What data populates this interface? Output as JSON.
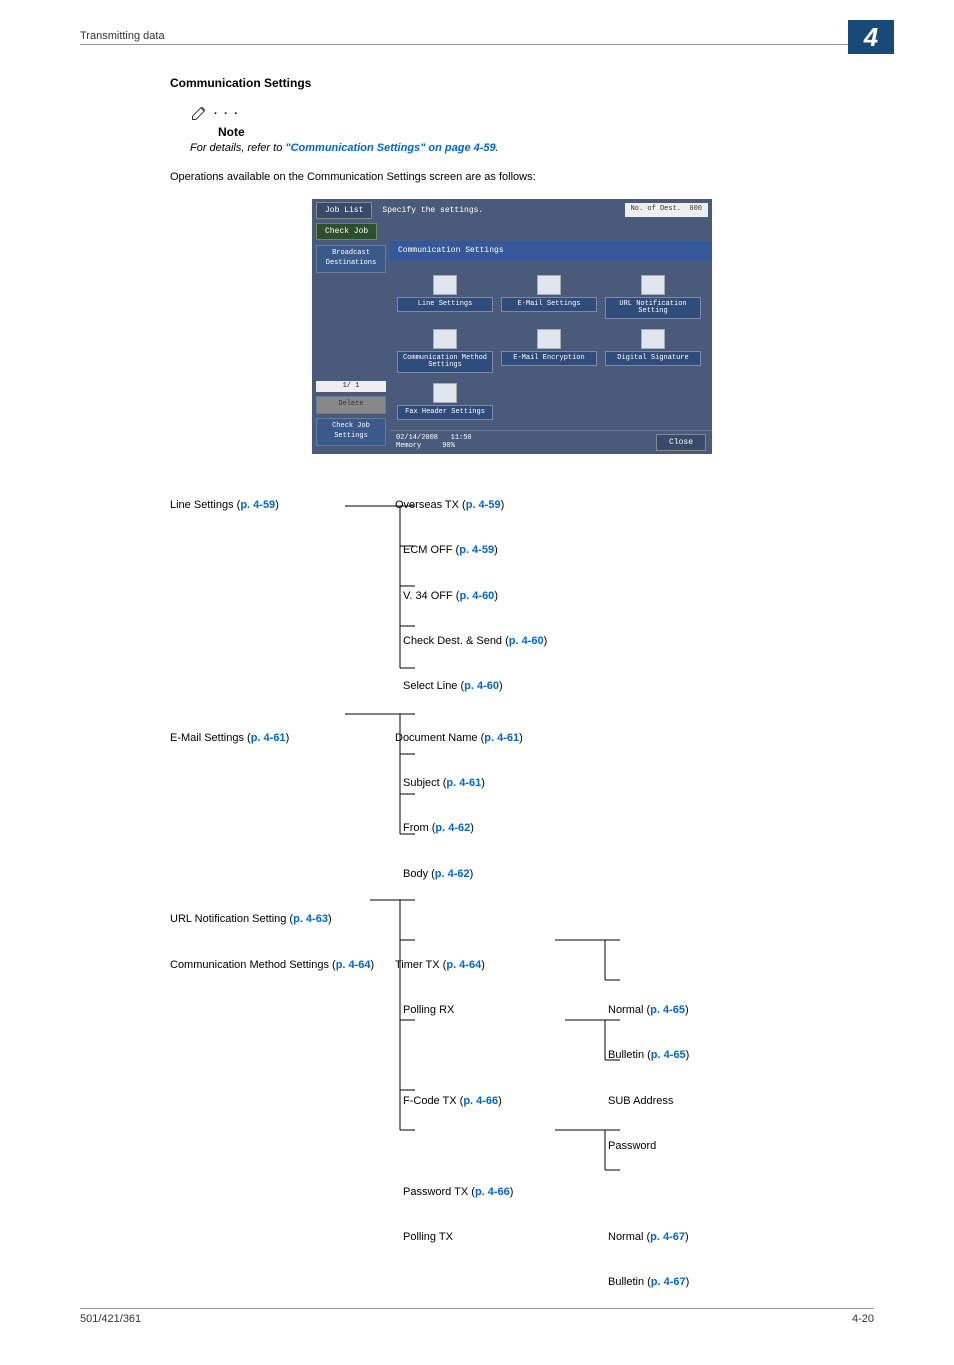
{
  "header": {
    "section": "Transmitting data",
    "chapter": "4"
  },
  "subheading": "Communication Settings",
  "note": {
    "label": "Note",
    "prefix": "For details, refer to ",
    "link": "\"Communication Settings\" on page 4-59",
    "suffix": "."
  },
  "intro": "Operations available on the Communication Settings screen are as follows:",
  "device": {
    "job_list": "Job List",
    "check_job": "Check Job",
    "header_text": "Specify the settings.",
    "dest_label": "No. of Dest.",
    "dest_count": "000",
    "tab": "Communication Settings",
    "side_broadcast": "Broadcast Destinations",
    "side_pager": "1/ 1",
    "side_delete": "Delete",
    "side_check": "Check Job Settings",
    "tiles": {
      "line": "Line Settings",
      "email": "E-Mail Settings",
      "url": "URL Notification Setting",
      "comm_method": "Communication Method Settings",
      "encrypt": "E-Mail Encryption",
      "dsig": "Digital Signature",
      "fax_header": "Fax Header Settings"
    },
    "footer_date": "02/14/2008",
    "footer_time": "11:50",
    "footer_mem_label": "Memory",
    "footer_mem_val": "90%",
    "close": "Close"
  },
  "tree": {
    "line_settings": {
      "label": "Line Settings (",
      "ref": "p. 4-59",
      "close": ")"
    },
    "overseas": {
      "label": "Overseas TX (",
      "ref": "p. 4-59",
      "close": ")"
    },
    "ecm_off": {
      "label": "ECM OFF (",
      "ref": "p. 4-59",
      "close": ")"
    },
    "v34_off": {
      "label": "V. 34 OFF (",
      "ref": "p. 4-60",
      "close": ")"
    },
    "check_dest": {
      "label": "Check Dest. & Send (",
      "ref": "p. 4-60",
      "close": ")"
    },
    "select_line": {
      "label": "Select Line (",
      "ref": "p. 4-60",
      "close": ")"
    },
    "email_settings": {
      "label": "E-Mail Settings (",
      "ref": "p. 4-61",
      "close": ")"
    },
    "doc_name": {
      "label": "Document Name (",
      "ref": "p. 4-61",
      "close": ")"
    },
    "subject": {
      "label": "Subject (",
      "ref": "p. 4-61",
      "close": ")"
    },
    "from": {
      "label": "From (",
      "ref": "p. 4-62",
      "close": ")"
    },
    "body": {
      "label": "Body (",
      "ref": "p. 4-62",
      "close": ")"
    },
    "url_notification": {
      "label": "URL Notification Setting (",
      "ref": "p. 4-63",
      "close": ")"
    },
    "comm_method": {
      "label": "Communication Method Settings (",
      "ref": "p. 4-64",
      "close": ")"
    },
    "timer_tx": {
      "label": "Timer TX (",
      "ref": "p. 4-64",
      "close": ")"
    },
    "polling_rx": {
      "label": "Polling RX"
    },
    "normal_rx": {
      "label": "Normal (",
      "ref": "p. 4-65",
      "close": ")"
    },
    "bulletin_rx": {
      "label": "Bulletin (",
      "ref": "p. 4-65",
      "close": ")"
    },
    "fcode_tx": {
      "label": "F-Code TX (",
      "ref": "p. 4-66",
      "close": ")"
    },
    "sub_addr": {
      "label": "SUB Address"
    },
    "password": {
      "label": "Password"
    },
    "password_tx": {
      "label": "Password TX (",
      "ref": "p. 4-66",
      "close": ")"
    },
    "polling_tx": {
      "label": "Polling TX"
    },
    "normal_tx": {
      "label": "Normal (",
      "ref": "p. 4-67",
      "close": ")"
    },
    "bulletin_tx": {
      "label": "Bulletin (",
      "ref": "p. 4-67",
      "close": ")"
    }
  },
  "footer": {
    "left": "501/421/361",
    "right": "4-20"
  }
}
